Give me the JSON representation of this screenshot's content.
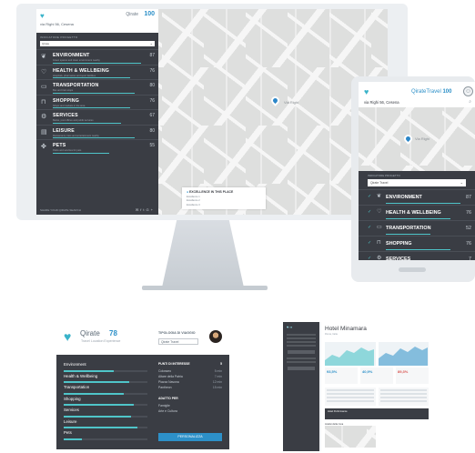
{
  "desktop": {
    "brand": "Qirate",
    "score": "100",
    "address": "via Righi 56, Cesena",
    "projects_label": "INDICATORE PROGETTO",
    "project_value": "Qirate",
    "categories": [
      {
        "name": "ENVIRONMENT",
        "desc": "Green spaces and clean environment nearby",
        "value": "87",
        "icon": "leaf-icon",
        "pct": 87
      },
      {
        "name": "HEALTH & WELLBEING",
        "desc": "Hospitals, pharmacies and sport facilities",
        "value": "76",
        "icon": "heart-icon",
        "pct": 76
      },
      {
        "name": "TRANSPORTATION",
        "desc": "Bus and train stops",
        "value": "80",
        "icon": "bus-icon",
        "pct": 80
      },
      {
        "name": "SHOPPING",
        "desc": "Shops and markets in the area",
        "value": "76",
        "icon": "bag-icon",
        "pct": 76
      },
      {
        "name": "SERVICES",
        "desc": "Banks, post offices and public services",
        "value": "67",
        "icon": "wrench-icon",
        "pct": 67
      },
      {
        "name": "LEISURE",
        "desc": "Restaurants, bars and entertainment nearby",
        "value": "80",
        "icon": "ticket-icon",
        "pct": 80
      },
      {
        "name": "PETS",
        "desc": "Parks and services for pets",
        "value": "55",
        "icon": "paw-icon",
        "pct": 55
      }
    ],
    "footer_share": "SHARE YOUR QIRATE SEARCH",
    "excel_title": "EXCELLENCE IN THIS PLACE",
    "excel_lines": [
      "Excellence 1",
      "Excellence 2",
      "Excellence 3"
    ],
    "map_street": "Via Righi"
  },
  "tablet": {
    "brand": "QirateTravel",
    "score": "100",
    "address": "via Righi 56, Cesena",
    "map_label": "Via Righi",
    "projects_label": "INDICATORE PROGETTO",
    "project_value": "Qirate Travel",
    "categories": [
      {
        "name": "ENVIRONMENT",
        "value": "87",
        "icon": "leaf-icon",
        "pct": 87
      },
      {
        "name": "HEALTH & WELLBEING",
        "value": "76",
        "icon": "heart-icon",
        "pct": 76
      },
      {
        "name": "TRANSPORTATION",
        "value": "52",
        "icon": "bus-icon",
        "pct": 52
      },
      {
        "name": "SHOPPING",
        "value": "76",
        "icon": "bag-icon",
        "pct": 76
      },
      {
        "name": "SERVICES",
        "value": "7",
        "icon": "wrench-icon",
        "pct": 70
      }
    ]
  },
  "card": {
    "brand": "Qirate",
    "score": "78",
    "subtitle": "Travel Location Experience",
    "type_label": "TIPOLOGIA DI VIAGGIO",
    "type_value": "Qirate Travel",
    "categories": [
      {
        "name": "Environment",
        "pct": 60
      },
      {
        "name": "Health & Wellbeing",
        "pct": 78
      },
      {
        "name": "Transportation",
        "pct": 72
      },
      {
        "name": "Shopping",
        "pct": 84
      },
      {
        "name": "Services",
        "pct": 80
      },
      {
        "name": "Leisure",
        "pct": 88
      },
      {
        "name": "Pets",
        "pct": 22
      }
    ],
    "poi_title": "PUNTI DI INTERESSE",
    "poi_count": "5",
    "pois": [
      {
        "name": "Colosseo",
        "dist": "5 min"
      },
      {
        "name": "Altare della Patria",
        "dist": "7 min"
      },
      {
        "name": "Piazza Navona",
        "dist": "12 min"
      },
      {
        "name": "Pantheon",
        "dist": "15 min"
      }
    ],
    "fit_title": "ADATTO PER",
    "fits": [
      "Famiglie",
      "Arte e Cultura"
    ],
    "button": "PERSONALIZZA"
  },
  "dashboard": {
    "title": "Hotel Minamara",
    "subtitle": "Roma, Italia",
    "stats": [
      "93,5%",
      "40,9%",
      "89,3%"
    ],
    "section": "Hotel Performance",
    "map_title": "Analisi della zona"
  },
  "colors": {
    "accent": "#4fc5c9",
    "brand_blue": "#2d90c8",
    "panel": "#3a3d44"
  }
}
